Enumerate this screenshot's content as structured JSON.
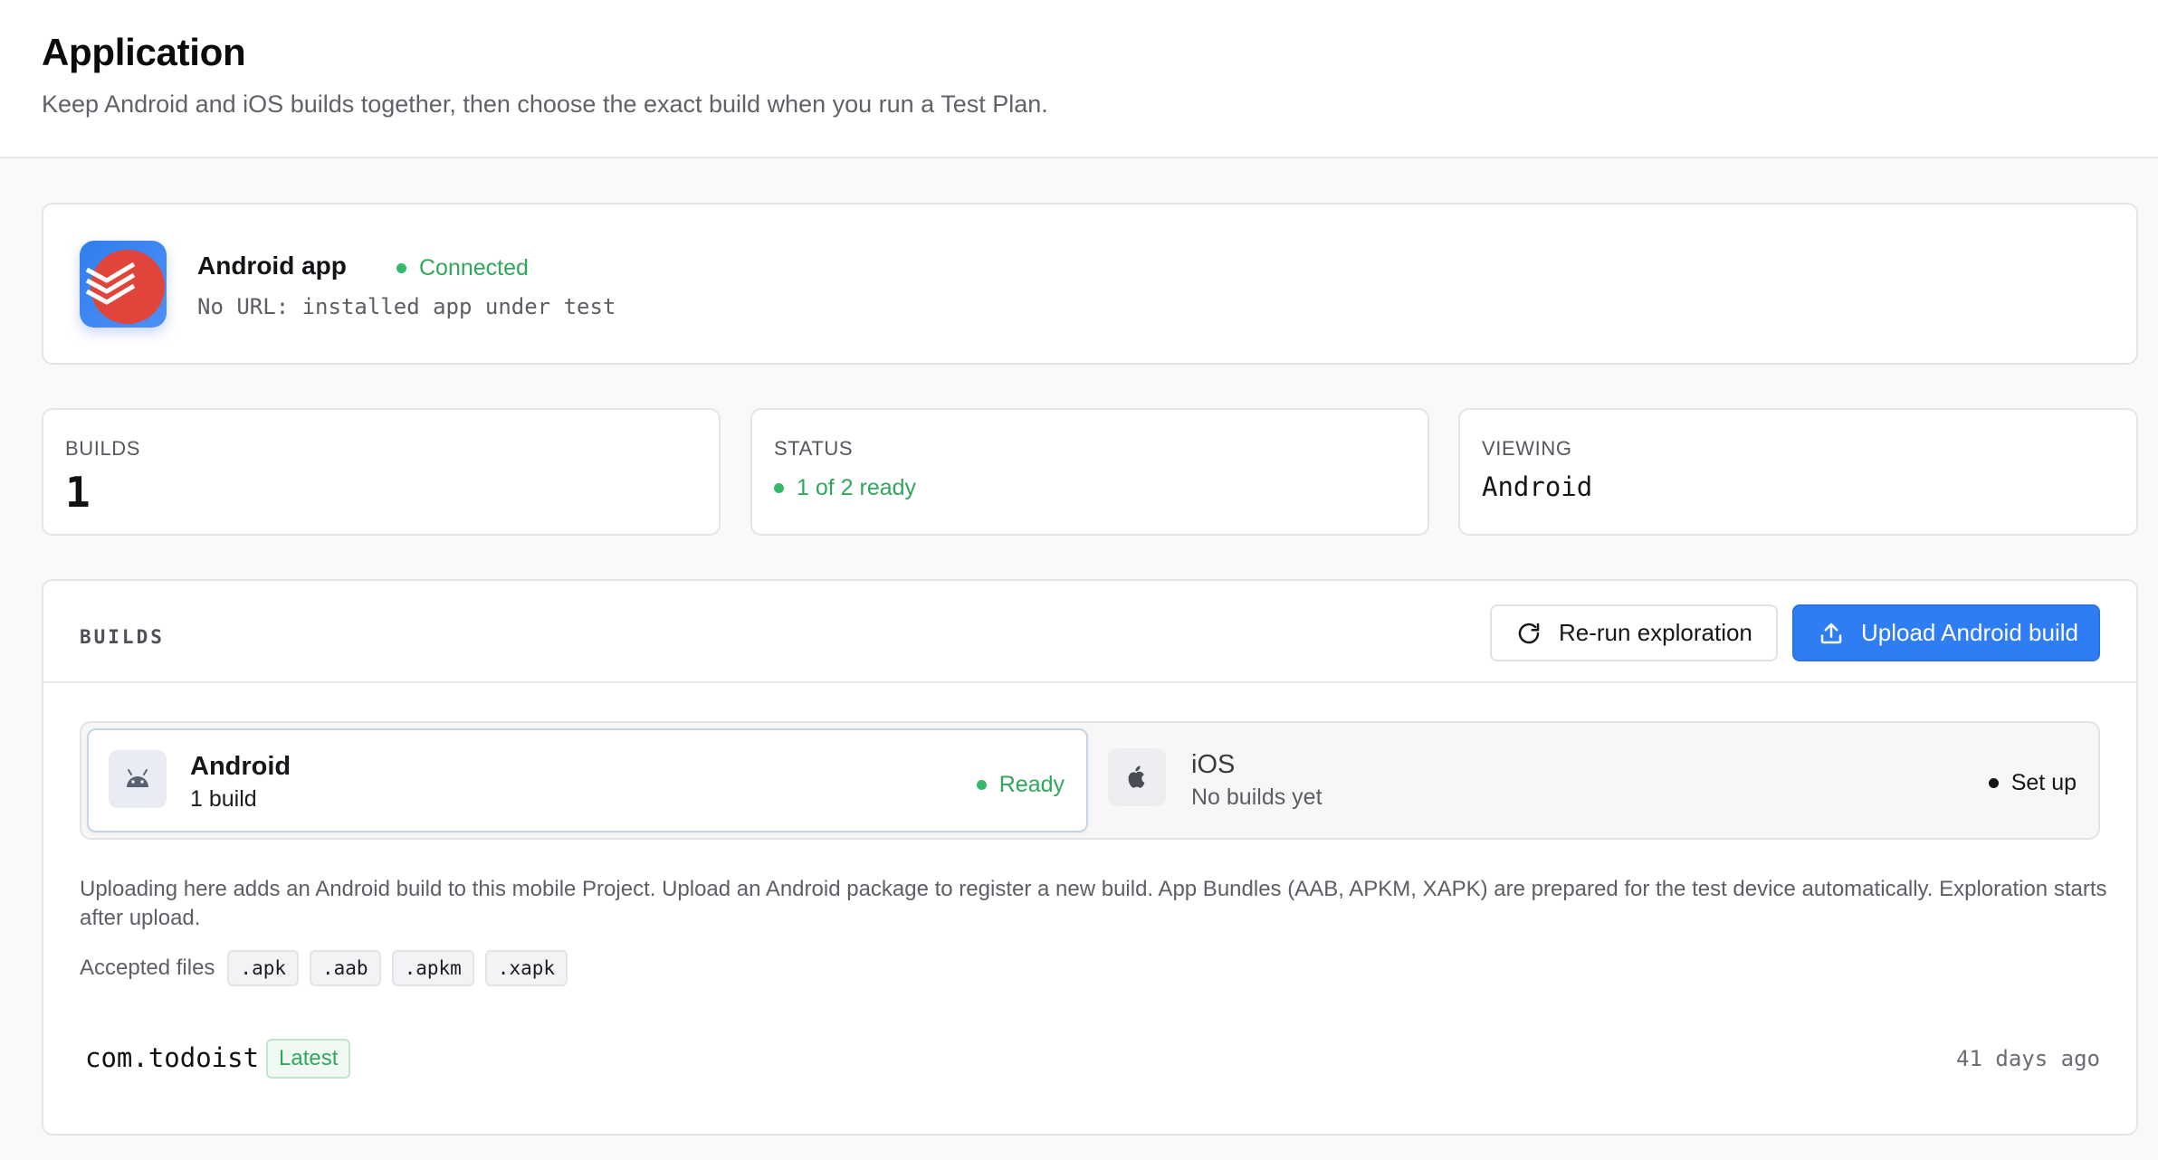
{
  "header": {
    "title": "Application",
    "subtitle": "Keep Android and iOS builds together, then choose the exact build when you run a Test Plan."
  },
  "app": {
    "name": "Android app",
    "status": "Connected",
    "url_text": "No URL: installed app under test",
    "icon": "todoist-app-icon"
  },
  "stats": {
    "builds_label": "BUILDS",
    "builds_value": "1",
    "status_label": "STATUS",
    "status_value": "1 of 2 ready",
    "viewing_label": "VIEWING",
    "viewing_value": "Android"
  },
  "builds": {
    "title": "BUILDS",
    "rerun_label": "Re-run exploration",
    "upload_label": "Upload Android build",
    "platforms": [
      {
        "name": "Android",
        "sub": "1 build",
        "status": "Ready",
        "icon": "android-icon"
      },
      {
        "name": "iOS",
        "sub": "No builds yet",
        "status": "Set up",
        "icon": "apple-icon"
      }
    ],
    "description": "Uploading here adds an Android build to this mobile Project. Upload an Android package to register a new build. App Bundles (AAB, APKM, XAPK) are prepared for the test device automatically. Exploration starts after upload.",
    "accepted_label": "Accepted files",
    "accepted_files": [
      ".apk",
      ".aab",
      ".apkm",
      ".xapk"
    ],
    "list": [
      {
        "package": "com.todoist",
        "badge": "Latest",
        "time": "41 days ago"
      }
    ]
  },
  "colors": {
    "accent": "#2f7df2",
    "success": "#2fa85b",
    "brand_icon": "#e0443a"
  }
}
